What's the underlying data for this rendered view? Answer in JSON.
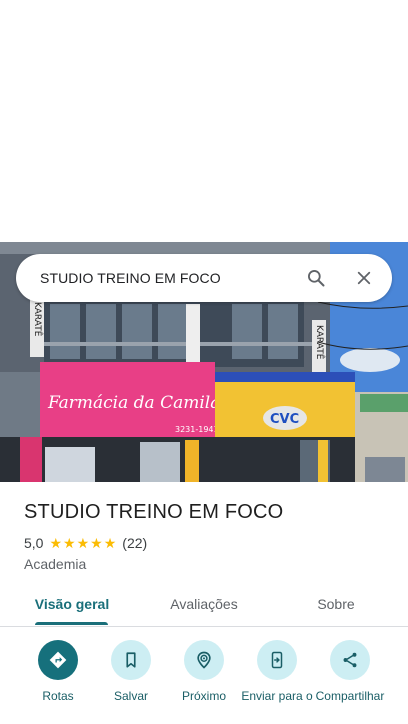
{
  "search": {
    "query": "STUDIO TREINO EM FOCO"
  },
  "photo": {
    "signs": {
      "pharmacy": "Farmácia da Camila",
      "phone": "3231-1941",
      "agency": "CVC",
      "karate_left": "KARATÊ",
      "karate_right": "KARATÊ",
      "vertical_middle": "ACADEMIA"
    }
  },
  "place": {
    "name": "STUDIO TREINO EM FOCO",
    "rating": "5,0",
    "stars": 5,
    "review_count": "(22)",
    "category": "Academia"
  },
  "tabs": [
    {
      "label": "Visão geral",
      "active": true
    },
    {
      "label": "Avaliações",
      "active": false
    },
    {
      "label": "Sobre",
      "active": false
    }
  ],
  "actions": [
    {
      "label": "Rotas",
      "icon": "directions-icon"
    },
    {
      "label": "Salvar",
      "icon": "bookmark-icon"
    },
    {
      "label": "Próximo",
      "icon": "nearby-icon"
    },
    {
      "label": "Enviar para o",
      "icon": "send-to-phone-icon"
    },
    {
      "label": "Compartilhar",
      "icon": "share-icon"
    }
  ],
  "colors": {
    "accent": "#1a6f7a",
    "action_bg": "#cdeef3",
    "star": "#fbbc04"
  }
}
